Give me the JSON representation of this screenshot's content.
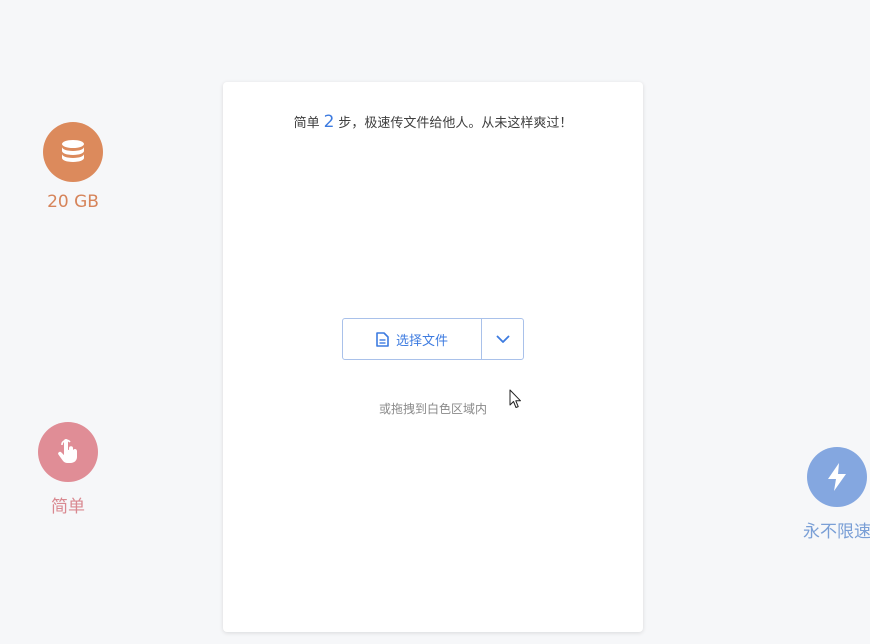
{
  "features": {
    "storage": {
      "label": "20 GB",
      "icon": "database-icon",
      "color": "#dc8a5c"
    },
    "simple": {
      "label": "简单",
      "icon": "hand-pointer-icon",
      "color": "#e08d96"
    },
    "speed": {
      "label": "永不限速",
      "icon": "lightning-bolt-icon",
      "color": "#84a7e0"
    }
  },
  "card": {
    "headline_pre": "简单",
    "headline_num": "2",
    "headline_post": "步，极速传文件给他人。从未这样爽过！",
    "select_file_label": "选择文件",
    "drop_hint": "或拖拽到白色区域内"
  },
  "colors": {
    "accent": "#3d7be0",
    "background": "#f6f7f9",
    "card": "#ffffff"
  }
}
